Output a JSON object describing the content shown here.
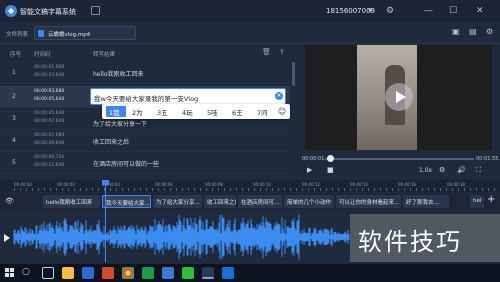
{
  "app": {
    "title": "智能文稿字幕系统",
    "phone": "18156007009",
    "window_icons": [
      "dropdown-icon",
      "gear-icon",
      "minimize-icon",
      "maximize-icon",
      "close-icon"
    ]
  },
  "filebar": {
    "label": "文件列表",
    "file_name": "云蟾蟾vlog.mp4"
  },
  "table": {
    "headers": {
      "index": "序号",
      "time": "时间码",
      "result": "转写结果"
    },
    "rows": [
      {
        "index": "1",
        "start": "00:00:01,000",
        "end": "00:00:03,640",
        "text": "hello我刚收工回来"
      },
      {
        "index": "2",
        "start": "00:00:03,680",
        "end": "00:00:05,640",
        "text": "我w今天要给大家录我的第一支Vlog",
        "active": true
      },
      {
        "index": "3",
        "start": "00:00:05,640",
        "end": "00:00:07,640",
        "text": "为了给大家分享一下"
      },
      {
        "index": "4",
        "start": "00:00:07,680",
        "end": "00:00:09,640",
        "text": "收工回来之后"
      },
      {
        "index": "5",
        "start": "00:00:09,720",
        "end": "00:00:11,640",
        "text": "在酒店房间可以做的一些"
      }
    ]
  },
  "ime": {
    "candidates": [
      "1我",
      "2为",
      "3五",
      "4玩",
      "5哇",
      "6王",
      "7问"
    ]
  },
  "video": {
    "current_time": "00:00:01",
    "total_time": "00:01:55",
    "progress": 0.02,
    "speed": "1.0x"
  },
  "timeline": {
    "ticks": [
      "00:00:00",
      "00:00:02",
      "00:00:04",
      "00:00:06",
      "00:00:08",
      "00:00:10",
      "00:00:12",
      "00:00:14",
      "00:00:16",
      "00:00:18"
    ],
    "segments": [
      "hello我刚收工回来",
      "我今天要给大家...",
      "为了给大家分享...",
      "收工回来之后",
      "在酒店房间可...",
      "简单的几个小动作",
      "可以让你的身材看起来...",
      "好了那我去...",
      "hel"
    ]
  },
  "watermark": "软件技巧"
}
